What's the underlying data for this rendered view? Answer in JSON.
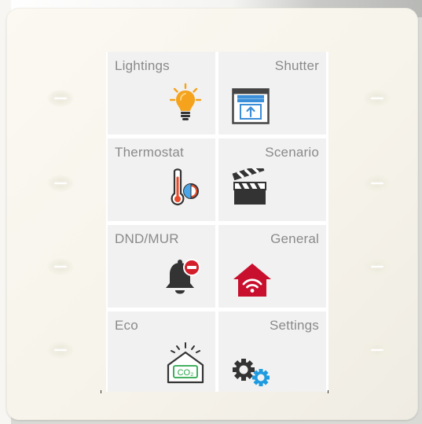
{
  "tiles": [
    {
      "label": "Lightings",
      "icon": "lightbulb-icon"
    },
    {
      "label": "Shutter",
      "icon": "shutter-icon"
    },
    {
      "label": "Thermostat",
      "icon": "thermostat-icon"
    },
    {
      "label": "Scenario",
      "icon": "clapperboard-icon"
    },
    {
      "label": "DND/MUR",
      "icon": "bell-dnd-icon"
    },
    {
      "label": "General",
      "icon": "home-wifi-icon"
    },
    {
      "label": "Eco",
      "icon": "co2-house-icon"
    },
    {
      "label": "Settings",
      "icon": "gears-icon"
    }
  ],
  "eco": {
    "co2_text": "CO₂"
  },
  "colors": {
    "tile_bg": "#f1f1f1",
    "label": "#8a8a8a",
    "bulb": "#f5a21c",
    "shutter_blue": "#3b8ed8",
    "red": "#c8102e",
    "green": "#2aa84a",
    "gear_blue": "#1e9be0"
  }
}
